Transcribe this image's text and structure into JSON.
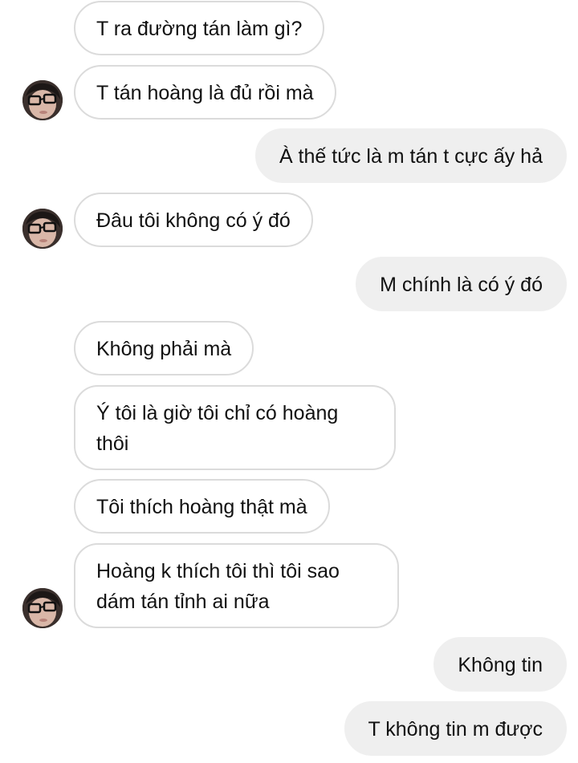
{
  "conversation": {
    "messages": [
      {
        "side": "incoming",
        "text": "T ra đường tán làm gì?"
      },
      {
        "side": "incoming",
        "text": "T tán hoàng là đủ rồi mà"
      },
      {
        "side": "outgoing",
        "text": "À thế tức là m tán t cực ấy hả"
      },
      {
        "side": "incoming",
        "text": "Đâu tôi không có ý đó"
      },
      {
        "side": "outgoing",
        "text": "M chính là có ý đó"
      },
      {
        "side": "incoming",
        "text": "Không phải mà"
      },
      {
        "side": "incoming",
        "text": "Ý tôi là giờ tôi chỉ có hoàng thôi"
      },
      {
        "side": "incoming",
        "text": "Tôi thích hoàng thật mà"
      },
      {
        "side": "incoming",
        "text": "Hoàng k thích tôi thì tôi sao dám tán tỉnh ai nữa"
      },
      {
        "side": "outgoing",
        "text": "Không tin"
      },
      {
        "side": "outgoing",
        "text": "T không tin m được"
      }
    ]
  },
  "theme": {
    "incoming_border": "#dbdbdb",
    "outgoing_bg": "#efefef",
    "text_color": "#111111"
  }
}
